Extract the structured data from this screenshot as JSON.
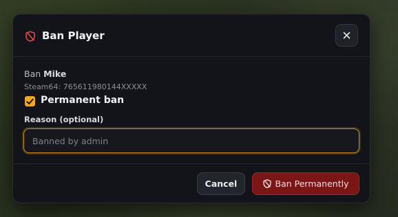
{
  "dialog": {
    "title": "Ban Player",
    "title_icon": "shield-off-icon",
    "close_icon": "close-icon"
  },
  "body": {
    "ban_prefix": "Ban",
    "player_name": "Mike",
    "steam_id": "Steam64: 765611980144XXXXX",
    "permanent_label": "Permanent ban",
    "permanent_checked": true,
    "reason_label": "Reason (optional)",
    "reason_value": "",
    "reason_placeholder": "Banned by admin"
  },
  "footer": {
    "cancel_label": "Cancel",
    "confirm_label": "Ban Permanently",
    "confirm_icon": "shield-off-icon"
  },
  "colors": {
    "accent": "#f0a81e",
    "danger": "#7a1616",
    "danger_icon": "#e0484b",
    "surface": "#121419"
  }
}
